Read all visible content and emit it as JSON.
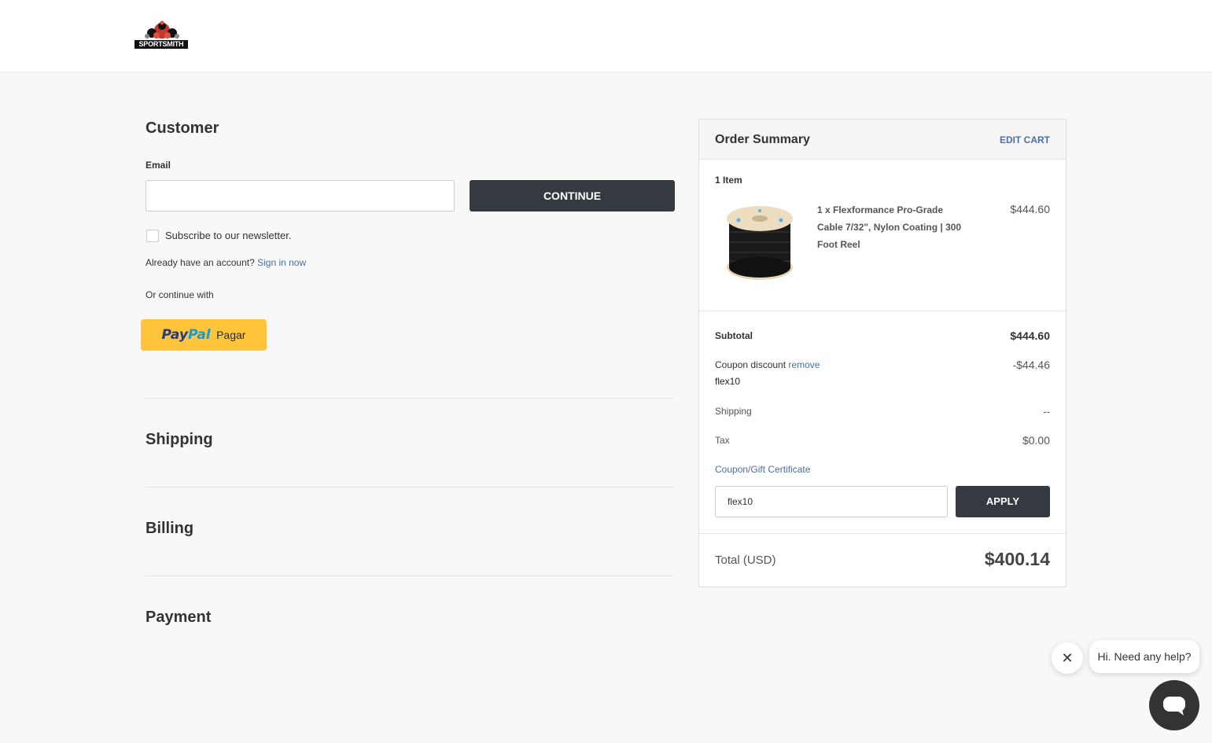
{
  "header": {
    "logo_text": "SPORTSMITH"
  },
  "customer": {
    "title": "Customer",
    "email_label": "Email",
    "email_value": "",
    "continue_label": "CONTINUE",
    "newsletter_label": "Subscribe to our newsletter.",
    "account_prompt": "Already have an account?",
    "sign_in_link": "Sign in now",
    "or_continue": "Or continue with",
    "paypal": {
      "pay": "Pay",
      "pal": "Pal",
      "action": "Pagar"
    }
  },
  "sections": {
    "shipping": "Shipping",
    "billing": "Billing",
    "payment": "Payment"
  },
  "summary": {
    "title": "Order Summary",
    "edit_cart": "EDIT CART",
    "item_count": "1 Item",
    "item": {
      "name_line1": "1 x Flexformance Pro-Grade",
      "name_line2": "Cable 7/32\", Nylon Coating | 300",
      "name_line3": "Foot Reel",
      "price": "$444.60"
    },
    "subtotal_label": "Subtotal",
    "subtotal_value": "$444.60",
    "coupon_label": "Coupon discount",
    "coupon_remove": "remove",
    "coupon_code": "flex10",
    "coupon_value": "-$44.46",
    "shipping_label": "Shipping",
    "shipping_value": "--",
    "tax_label": "Tax",
    "tax_value": "$0.00",
    "coupon_gift_link": "Coupon/Gift Certificate",
    "coupon_input_value": "flex10",
    "apply_label": "APPLY",
    "total_label": "Total (USD)",
    "total_value": "$400.14"
  },
  "chat": {
    "message": "Hi. Need any help?",
    "close_glyph": "✕"
  },
  "colors": {
    "dark_button": "#343a40",
    "link": "#4a6fa5",
    "paypal_yellow": "#ffc439",
    "background": "#f8f8f8"
  }
}
